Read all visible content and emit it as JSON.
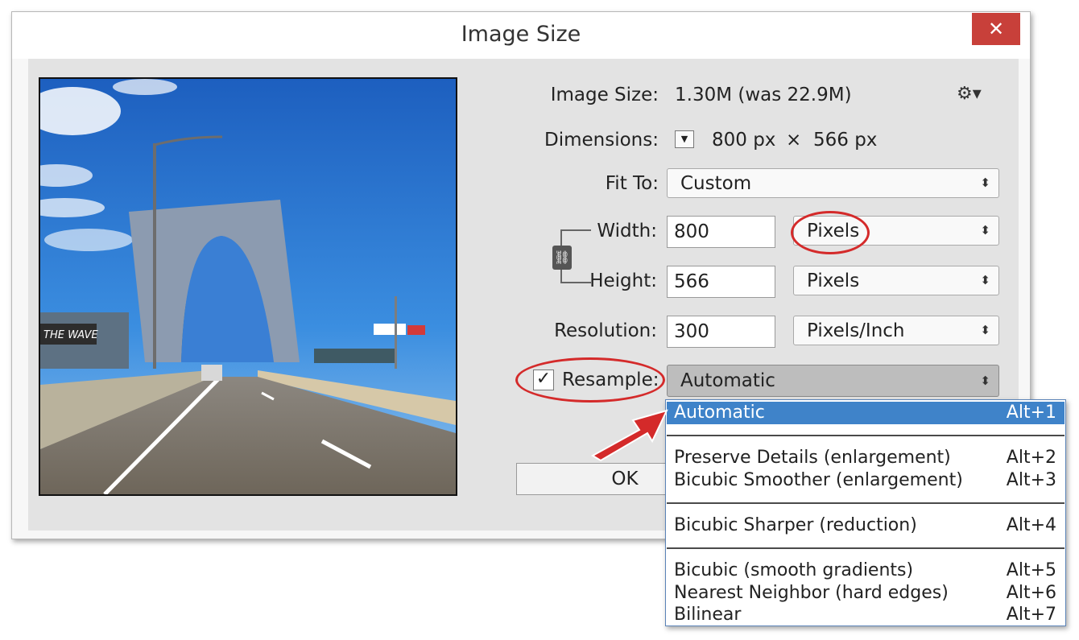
{
  "window": {
    "title": "Image Size",
    "close_glyph": "✕"
  },
  "info": {
    "image_size_label": "Image Size:",
    "image_size_value": "1.30M (was 22.9M)",
    "dimensions_label": "Dimensions:",
    "dimensions_width": "800 px",
    "dimensions_times": "×",
    "dimensions_height": "566 px",
    "gear_icon": "gear-icon",
    "gear_glyph": "⚙▾"
  },
  "fit_to": {
    "label": "Fit To:",
    "value": "Custom"
  },
  "width": {
    "label": "Width:",
    "value": "800",
    "unit": "Pixels"
  },
  "height": {
    "label": "Height:",
    "value": "566",
    "unit": "Pixels"
  },
  "resolution": {
    "label": "Resolution:",
    "value": "300",
    "unit": "Pixels/Inch"
  },
  "resample": {
    "label": "Resample:",
    "checked": true,
    "check_glyph": "✓",
    "value": "Automatic"
  },
  "buttons": {
    "ok": "OK"
  },
  "select_arrows": "⬍",
  "dropdown": {
    "items": [
      {
        "label": "Automatic",
        "shortcut": "Alt+1",
        "selected": true
      },
      {
        "label": "Preserve Details (enlargement)",
        "shortcut": "Alt+2"
      },
      {
        "label": "Bicubic Smoother (enlargement)",
        "shortcut": "Alt+3"
      },
      {
        "label": "Bicubic Sharper (reduction)",
        "shortcut": "Alt+4"
      },
      {
        "label": "Bicubic (smooth gradients)",
        "shortcut": "Alt+5"
      },
      {
        "label": "Nearest Neighbor (hard edges)",
        "shortcut": "Alt+6"
      },
      {
        "label": "Bilinear",
        "shortcut": "Alt+7"
      }
    ]
  },
  "preview": {
    "sign_text": "THE WAVE"
  },
  "colors": {
    "annotation": "#d42a2a",
    "selection": "#3f83c9",
    "close": "#c8403a"
  }
}
